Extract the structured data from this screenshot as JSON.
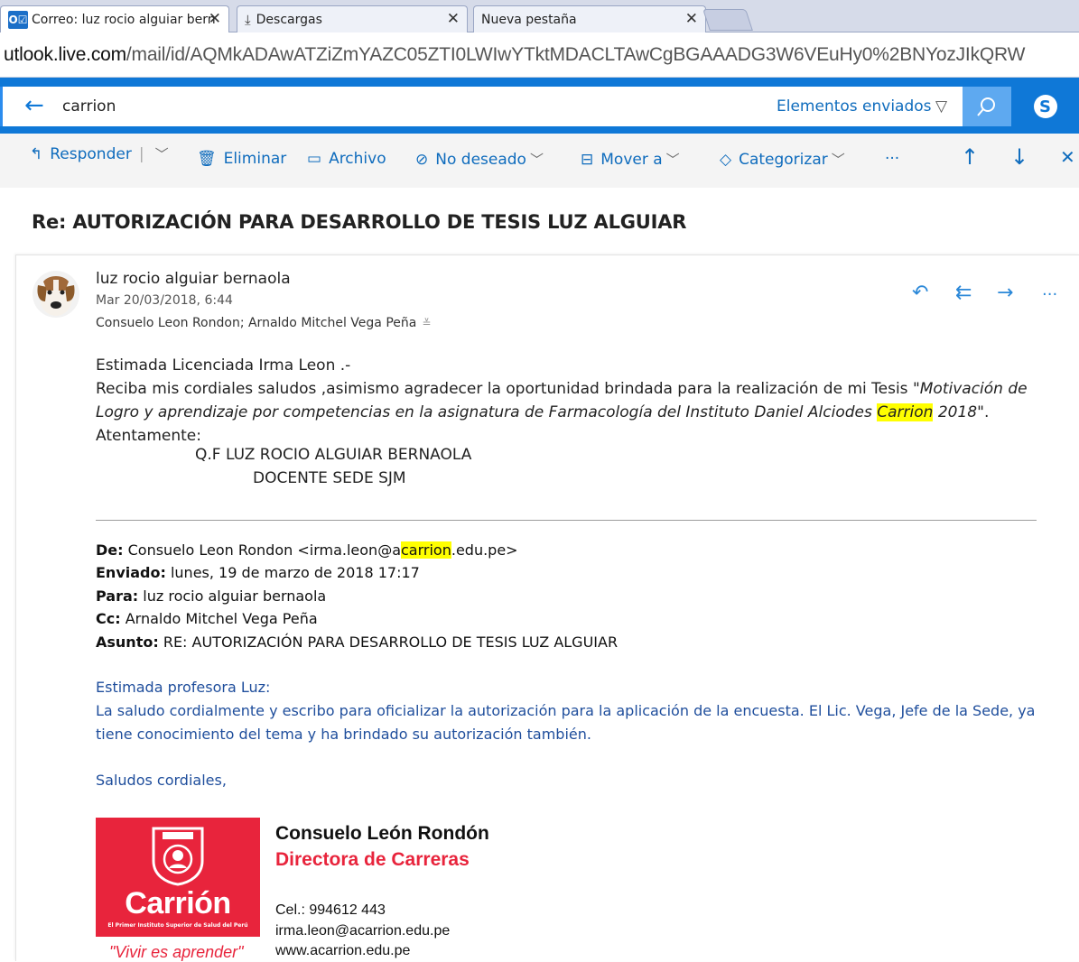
{
  "browser": {
    "tabs": [
      {
        "label": "Correo: luz rocio alguiar bern",
        "icon": "outlook-icon",
        "active": true
      },
      {
        "label": "Descargas",
        "icon": "download-icon",
        "active": false
      },
      {
        "label": "Nueva pestaña",
        "icon": "",
        "active": false
      }
    ],
    "close_glyph": "✕",
    "url_host": "utlook.live.com",
    "url_path": "/mail/id/AQMkADAwATZiZmYAZC05ZTI0LWIwYTktMDACLTAwCgBGAAADG3W6VEuHy0%2BNYozJIkQRW"
  },
  "search": {
    "query": "carrion",
    "scope_label": "Elementos enviados"
  },
  "toolbar": {
    "reply": "Responder",
    "delete": "Eliminar",
    "archive": "Archivo",
    "junk": "No deseado",
    "move": "Mover a",
    "categorize": "Categorizar",
    "more": "···"
  },
  "message": {
    "subject": "Re: AUTORIZACIÓN PARA DESARROLLO DE TESIS LUZ ALGUIAR",
    "sender": "luz rocio alguiar bernaola",
    "date": "Mar 20/03/2018, 6:44",
    "recipients": "Consuelo Leon Rondon; Arnaldo Mitchel Vega Peña",
    "body": {
      "greeting": "Estimada Licenciada Irma Leon .-",
      "line_start": "Reciba mis cordiales saludos ,asimismo agradecer la oportunidad brindada para la realización de mi Tesis ",
      "quote_part1": "\"Motivación de Logro y aprendizaje por competencias en la asignatura de Farmacología del Instituto Daniel Alciodes ",
      "quote_highlight": "Carrion",
      "quote_part2": " 2018\"",
      "line_end": ".",
      "closing": "Atentamente:",
      "sig_name": "Q.F LUZ ROCIO ALGUIAR BERNAOLA",
      "sig_role": "DOCENTE SEDE SJM"
    }
  },
  "quoted": {
    "from_label": "De:",
    "from_before": " Consuelo Leon Rondon <irma.leon@a",
    "from_highlight": "carrion",
    "from_after": ".edu.pe>",
    "sent_label": "Enviado:",
    "sent_value": " lunes, 19 de marzo de 2018 17:17",
    "to_label": "Para:",
    "to_value": " luz rocio alguiar bernaola",
    "cc_label": "Cc:",
    "cc_value": " Arnaldo Mitchel Vega Peña",
    "subject_label": "Asunto:",
    "subject_value": " RE: AUTORIZACIÓN PARA DESARROLLO DE TESIS LUZ ALGUIAR",
    "greeting": "Estimada profesora Luz:",
    "body": "La saludo cordialmente y escribo para oficializar la autorización para la aplicación de la encuesta. El Lic. Vega, Jefe de la Sede, ya tiene conocimiento del tema y ha brindado su autorización también.",
    "sign_off": "Saludos cordiales,"
  },
  "signature": {
    "logo_word": "Carrión",
    "logo_tagline": "El Primer Instituto Superior de Salud del Perú",
    "motto": "\"Vivir es aprender\"",
    "name": "Consuelo León Rondón",
    "role": "Directora de Carreras",
    "phone": "Cel.: 994612 443",
    "email": "irma.leon@acarrion.edu.pe",
    "web": "www.acarrion.edu.pe"
  },
  "colors": {
    "outlook_blue": "#0f78d7",
    "link_blue": "#0f6cbd",
    "brand_red": "#e8243c",
    "highlight": "#ffff00"
  }
}
